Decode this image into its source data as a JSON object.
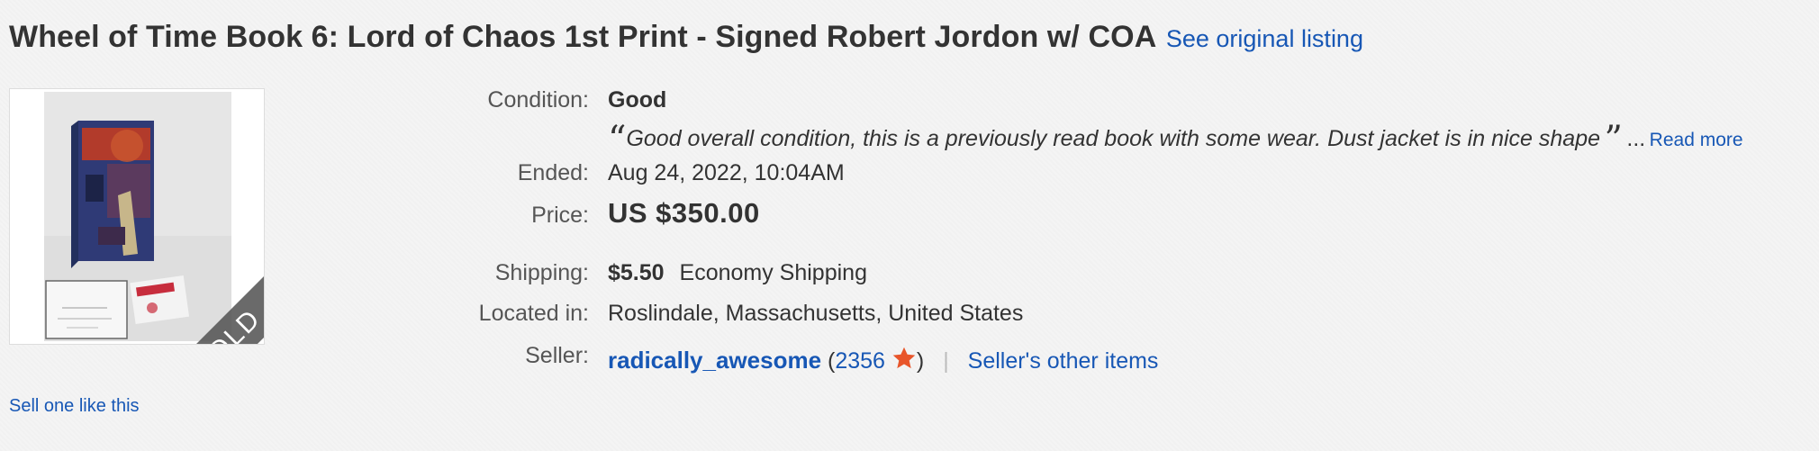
{
  "listing": {
    "title": "Wheel of Time Book 6: Lord of Chaos 1st Print - Signed Robert Jordon w/ COA",
    "see_original": "See original listing",
    "sold_badge": "SOLD"
  },
  "details": {
    "condition_label": "Condition:",
    "condition_value": "Good",
    "quote_open": "“",
    "quote_text": "Good overall condition, this is a previously read book with some wear. Dust jacket is in nice shape",
    "quote_close": "”",
    "ellipsis": "...",
    "read_more": "Read more",
    "ended_label": "Ended:",
    "ended_date": "Aug 24, 2022",
    "ended_time": ", 10:04AM",
    "price_label": "Price:",
    "price_value": "US $350.00",
    "shipping_label": "Shipping:",
    "shipping_cost": "$5.50",
    "shipping_method": "Economy Shipping",
    "location_label": "Located in:",
    "location_value": "Roslindale, Massachusetts, United States",
    "seller_label": "Seller:",
    "seller_name": "radically_awesome",
    "paren_open": "(",
    "feedback_score": "2356",
    "paren_close": ")",
    "separator": "|",
    "other_items": "Seller's other items"
  },
  "footer": {
    "sell_one": "Sell one like this"
  },
  "colors": {
    "link": "#1757b5",
    "text": "#333333",
    "label": "#555555",
    "star": "#e8552a"
  },
  "icons": {
    "feedback": "star-icon"
  }
}
